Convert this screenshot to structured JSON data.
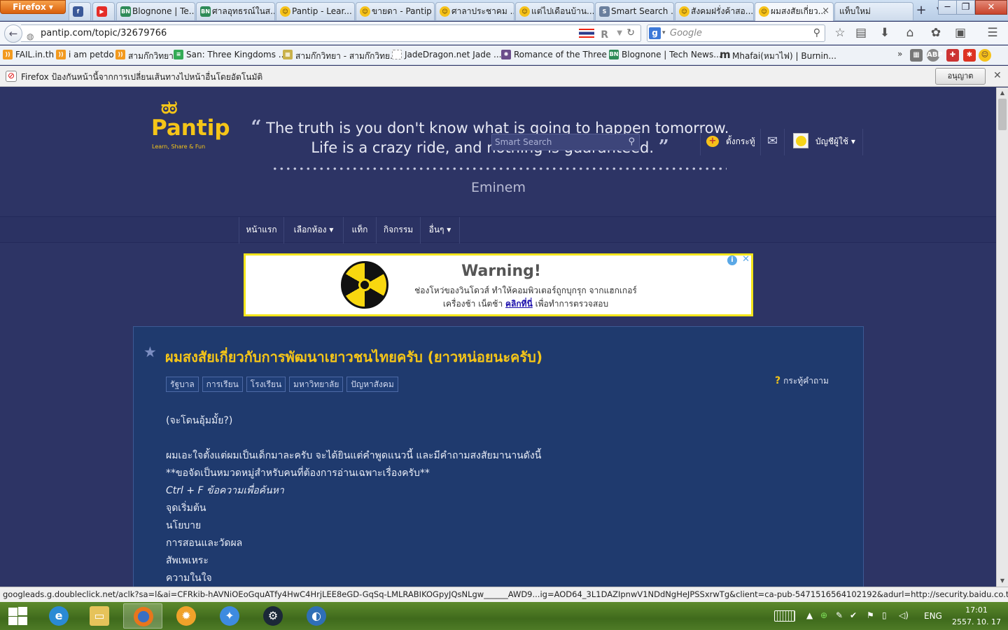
{
  "browser": {
    "menu_label": "Firefox",
    "tabs": [
      {
        "label": "",
        "icon": "facebook-icon"
      },
      {
        "label": "",
        "icon": "youtube-icon"
      },
      {
        "label": "Blognone | Te...",
        "icon": "blognone-icon"
      },
      {
        "label": "ศาลอุทธรณ์ในส...",
        "icon": "blognone-icon"
      },
      {
        "label": "Pantip - Lear...",
        "icon": "pantip-icon"
      },
      {
        "label": "ขายดา - Pantip",
        "icon": "pantip-icon"
      },
      {
        "label": "ศาลาประชาคม ...",
        "icon": "pantip-icon"
      },
      {
        "label": "แต่ไปเดือนบ้าน...",
        "icon": "pantip-icon"
      },
      {
        "label": "Smart Search ...",
        "icon": "smart-search-icon"
      },
      {
        "label": "สังคมฝรั่งค้าสอ...",
        "icon": "pantip-icon"
      },
      {
        "label": "ผมสงสัยเกี่ยว...",
        "icon": "pantip-icon"
      },
      {
        "label": "แท็บใหม่",
        "icon": ""
      }
    ],
    "url": "pantip.com/topic/32679766",
    "search_placeholder": "Google",
    "bookmarks": [
      {
        "label": "FAIL.in.th",
        "icon": "rss-icon"
      },
      {
        "label": "i am petdo",
        "icon": "rss-icon"
      },
      {
        "label": "สามก๊กวิทยา",
        "icon": "rss-icon"
      },
      {
        "label": "San: Three Kingdoms ...",
        "icon": "list-icon"
      },
      {
        "label": "สามก๊กวิทยา - สามก๊กวิทย...",
        "icon": "grid-icon"
      },
      {
        "label": "JadeDragon.net Jade ...",
        "icon": "blank-page-icon"
      },
      {
        "label": "Romance of the Three ...",
        "icon": "dragon-icon"
      },
      {
        "label": "Blognone | Tech News...",
        "icon": "blognone-icon"
      },
      {
        "label": "Mhafai(หมาไฟ) | Burnin...",
        "icon": "m-icon"
      }
    ],
    "bookmarks_more": "»",
    "notification": "Firefox ป้องกันหน้านี้จากการเปลี่ยนเส้นทางไปหน้าอื่นโดยอัตโนมัติ",
    "notification_allow": "อนุญาต",
    "status_url": "googleads.g.doubleclick.net/aclk?sa=l&ai=CFRkib-hAVNiOEoGquATfy4HwC4HrjLEE8eGD-GqSq-LMLRABIKOGpyJQsNLgw______AWD9...ig=AOD64_3L1DAZIpnwV1NDdNgHeJPSSxrwTg&client=ca-pub-5471516564102192&adurl=http://security.baidu.co.th/?adsense=1"
  },
  "site": {
    "logo_text": "Pantip",
    "logo_tagline": "Learn, Share & Fun",
    "quote_line1": "The truth is you don't know what is going to happen tomorrow.",
    "quote_line2": "Life is a crazy ride, and nothing is guaranteed.",
    "quote_author": "Eminem",
    "nav": {
      "home": "หน้าแรก",
      "rooms": "เลือกห้อง ▾",
      "tags": "แท็ก",
      "activities": "กิจกรรม",
      "more": "อื่นๆ ▾",
      "search_placeholder": "Smart Search",
      "new_topic": "ตั้งกระทู้",
      "account": "บัญชีผู้ใช้ ▾"
    }
  },
  "ad": {
    "title": "Warning!",
    "line1": "ช่องโหว่ของวินโดวส์ ทำให้คอมพิวเตอร์ถูกบุกรุก จากแฮกเกอร์",
    "line2_pre": "เครื่องช้า เน็ตช้า",
    "line2_link": "คลิกที่นี่",
    "line2_post": "เพื่อทำการตรวจสอบ"
  },
  "topic": {
    "title": "ผมสงสัยเกี่ยวกับการพัฒนาเยาวชนไทยครับ (ยาวหน่อยนะครับ)",
    "tags": [
      "รัฐบาล",
      "การเรียน",
      "โรงเรียน",
      "มหาวิทยาลัย",
      "ปัญหาสังคม"
    ],
    "type_label": "กระทู้คำถาม",
    "body": {
      "l1": "(จะโดนอุ้มมั้ย?)",
      "l2": "ผมเอะใจตั้งแต่ผมเป็นเด็กมาละครับ จะได้ยินแต่คำพูดแนวนี้  และมีคำถามสงสัยมานานดังนี้",
      "l3": "**ขอจัดเป็นหมวดหมู่สำหรับคนที่ต้องการอ่านเฉพาะเรื่องครับ**",
      "l4": "Ctrl + F ข้อความเพื่อค้นหา",
      "l5": "จุดเริ่มต้น",
      "l6": "นโยบาย",
      "l7": "การสอนและวัดผล",
      "l8": "สัพเพเหระ",
      "l9": "ความในใจ"
    }
  },
  "taskbar": {
    "lang": "ENG",
    "time": "17:01",
    "date": "2557. 10. 17"
  },
  "colors": {
    "page_bg": "#2d3465",
    "topic_bg": "#1f3a6e",
    "accent_yellow": "#f5c518",
    "ad_border": "#f3e51b"
  }
}
